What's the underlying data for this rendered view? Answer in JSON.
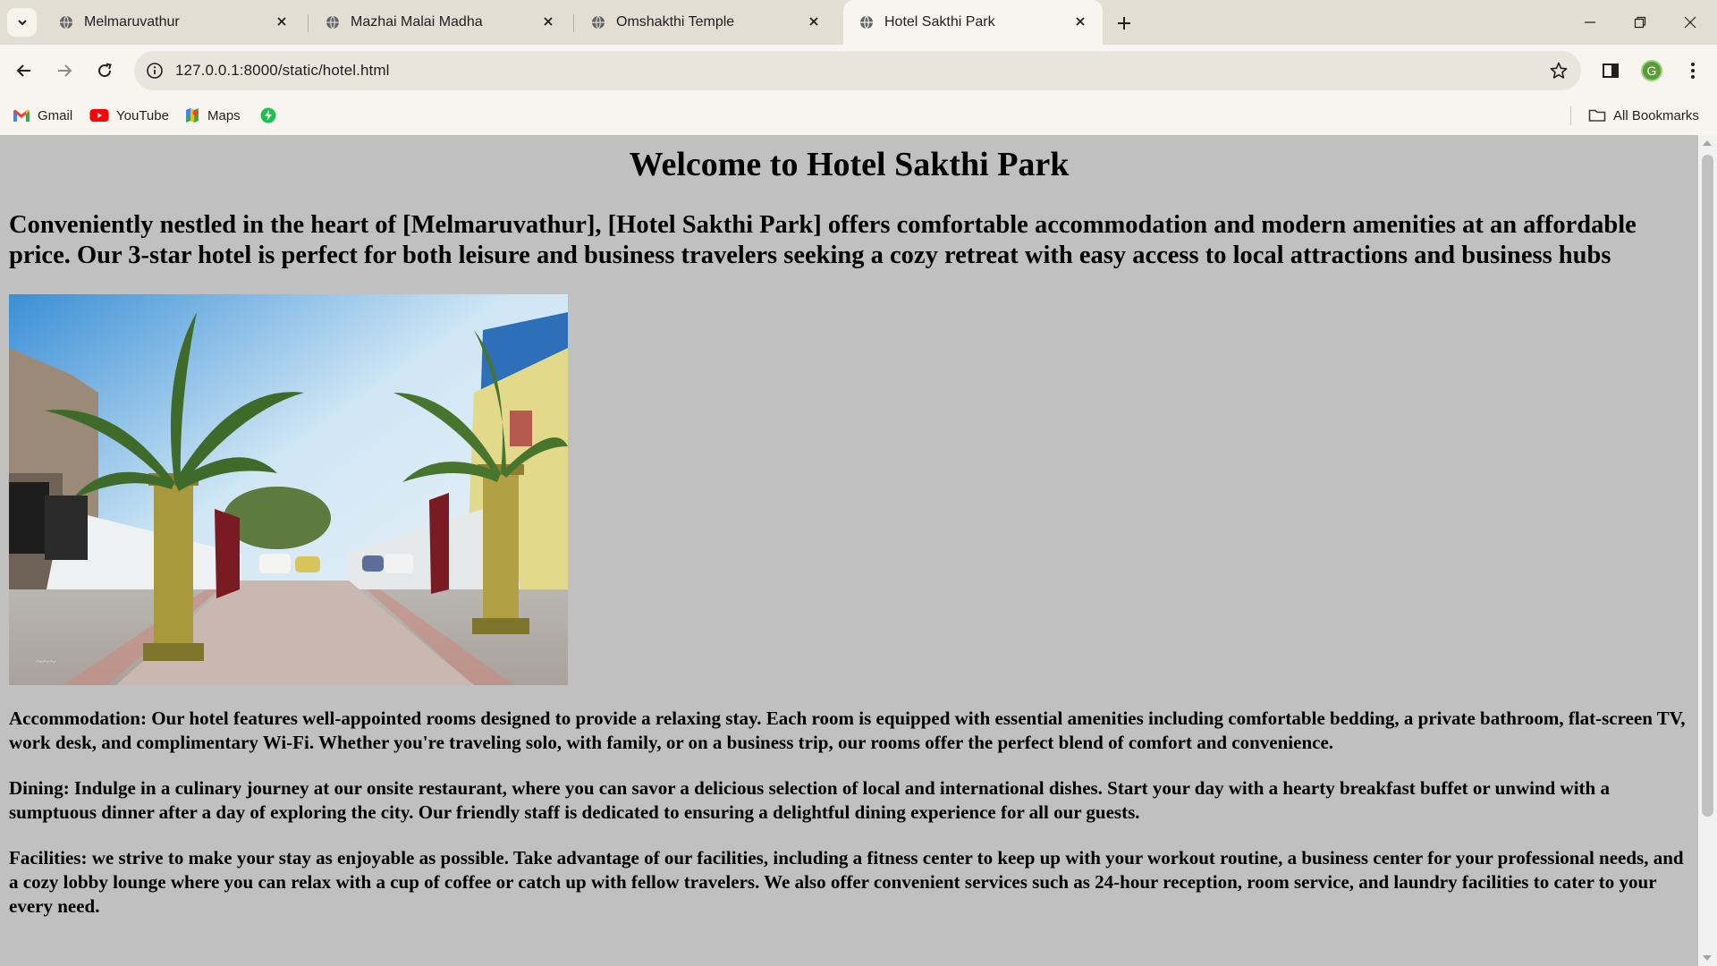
{
  "browser": {
    "tabs": [
      {
        "title": "Melmaruvathur"
      },
      {
        "title": "Mazhai Malai Madha"
      },
      {
        "title": "Omshakthi Temple"
      },
      {
        "title": "Hotel Sakthi Park"
      }
    ],
    "active_tab": 3,
    "url": "127.0.0.1:8000/static/hotel.html",
    "profile_initial": "G",
    "bookmarks": [
      {
        "label": "Gmail",
        "icon": "gmail-icon"
      },
      {
        "label": "YouTube",
        "icon": "youtube-icon"
      },
      {
        "label": "Maps",
        "icon": "maps-icon"
      },
      {
        "label": "",
        "icon": "green-bolt-icon"
      }
    ],
    "all_bookmarks_label": "All Bookmarks",
    "colors": {
      "frame": "#e3ddd3",
      "toolbar": "#f8f5f0",
      "page_bg": "#c0c0c0"
    }
  },
  "page": {
    "heading": "Welcome to Hotel Sakthi Park",
    "intro": "Conveniently nestled in the heart of [Melmaruvathur], [Hotel Sakthi Park] offers comfortable accommodation and modern amenities at an affordable price. Our 3-star hotel is perfect for both leisure and business travelers seeking a cozy retreat with easy access to local attractions and business hubs",
    "accommodation": "Accommodation: Our hotel features well-appointed rooms designed to provide a relaxing stay. Each room is equipped with essential amenities including comfortable bedding, a private bathroom, flat-screen TV, work desk, and complimentary Wi-Fi. Whether you're traveling solo, with family, or on a business trip, our rooms offer the perfect blend of comfort and convenience.",
    "dining": "Dining: Indulge in a culinary journey at our onsite restaurant, where you can savor a delicious selection of local and international dishes. Start your day with a hearty breakfast buffet or unwind with a sumptuous dinner after a day of exploring the city. Our friendly staff is dedicated to ensuring a delightful dining experience for all our guests.",
    "facilities": "Facilities: we strive to make your stay as enjoyable as possible. Take advantage of our facilities, including a fitness center to keep up with your workout routine, a business center for your professional needs, and a cozy lobby lounge where you can relax with a cup of coffee or catch up with fellow travelers. We also offer convenient services such as 24-hour reception, room service, and laundry facilities to cater to your every need."
  }
}
